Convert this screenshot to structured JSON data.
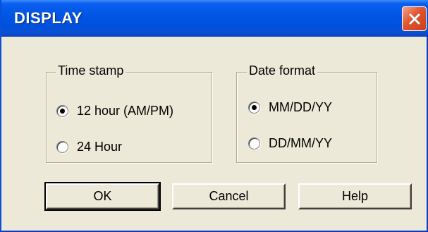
{
  "window": {
    "title": "DISPLAY",
    "close_icon": "close-icon"
  },
  "time_stamp": {
    "legend": "Time stamp",
    "options": [
      {
        "label": "12 hour (AM/PM)",
        "checked": true
      },
      {
        "label": "24 Hour",
        "checked": false
      }
    ]
  },
  "date_format": {
    "legend": "Date format",
    "options": [
      {
        "label": "MM/DD/YY",
        "checked": true
      },
      {
        "label": "DD/MM/YY",
        "checked": false
      }
    ]
  },
  "buttons": {
    "ok": "OK",
    "cancel": "Cancel",
    "help": "Help"
  },
  "colors": {
    "titlebar": "#0054e3",
    "dialog_bg": "#ece9d8",
    "close_button": "#e0552f"
  }
}
